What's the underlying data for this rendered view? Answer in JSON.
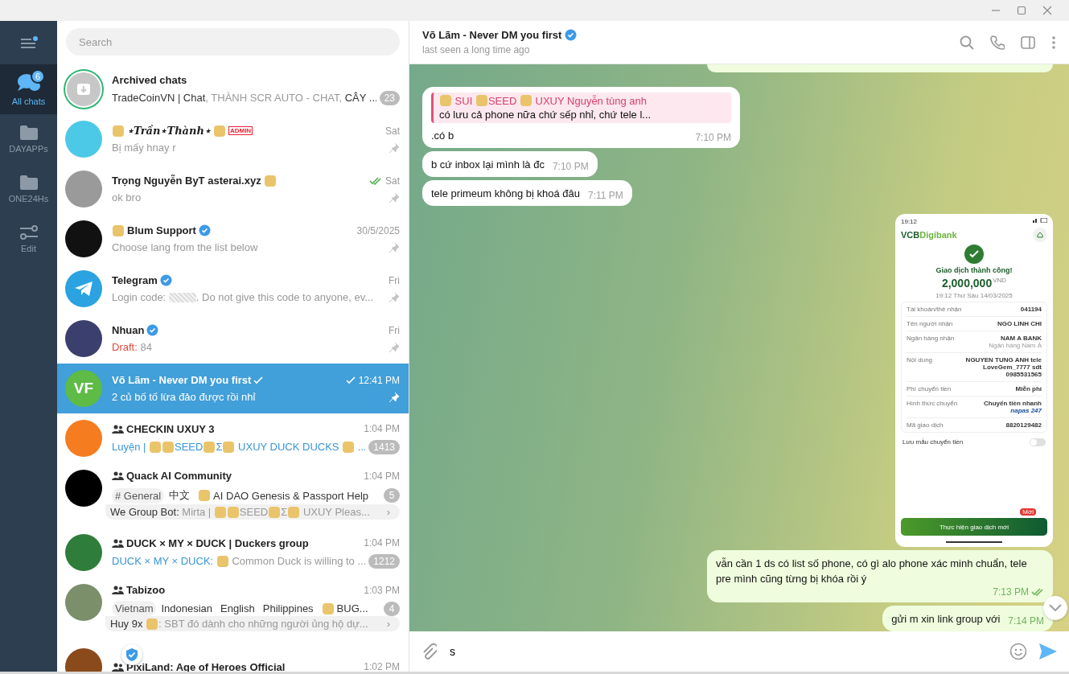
{
  "rail": {
    "items": [
      {
        "kind": "menu",
        "dot": true,
        "selected": false
      },
      {
        "kind": "chats",
        "label": "All chats",
        "badge": "6",
        "selected": true
      },
      {
        "kind": "folder",
        "label": "DAYAPPs",
        "selected": false
      },
      {
        "kind": "folder",
        "label": "ONE24Hs",
        "selected": false
      },
      {
        "kind": "edit",
        "label": "Edit",
        "selected": false
      }
    ]
  },
  "search": {
    "placeholder": "Search"
  },
  "chats": [
    {
      "avatar": {
        "kind": "archive"
      },
      "name": [
        {
          "kind": "text",
          "text": "Archived chats"
        }
      ],
      "preview": [
        {
          "kind": "name",
          "text": "TradeCoinVN | Chat"
        },
        {
          "kind": "text",
          "text": ", THÀNH SCR AUTO - CHAT, "
        },
        {
          "kind": "name",
          "text": "CÂY ..."
        }
      ],
      "unread": "23",
      "muted": true,
      "pinned": false,
      "selected": false
    },
    {
      "avatar": {
        "kind": "photo",
        "color": "#4cc9e6"
      },
      "name": [
        {
          "kind": "emoji"
        },
        {
          "kind": "fancy",
          "text": "⋆Trần⋆Thành⋆"
        },
        {
          "kind": "emoji"
        },
        {
          "kind": "tag",
          "text": "ADMIN"
        }
      ],
      "time": "Sat",
      "preview": [
        {
          "kind": "text",
          "text": "Bị mấy hnay r"
        }
      ],
      "pinned": true,
      "selected": false
    },
    {
      "avatar": {
        "kind": "photo",
        "color": "#9a9a9a"
      },
      "name": [
        {
          "kind": "text",
          "text": "Trọng Nguyễn ByT asterai.xyz"
        },
        {
          "kind": "emoji"
        }
      ],
      "sent": true,
      "read": true,
      "time": "Sat",
      "preview": [
        {
          "kind": "text",
          "text": "ok bro"
        }
      ],
      "pinned": true,
      "selected": false
    },
    {
      "avatar": {
        "kind": "photo",
        "color": "#111111"
      },
      "name": [
        {
          "kind": "emoji"
        },
        {
          "kind": "text",
          "text": "Blum Support"
        }
      ],
      "verified": true,
      "time": "30/5/2025",
      "preview": [
        {
          "kind": "text",
          "text": "Choose lang from the list below"
        }
      ],
      "pinned": true,
      "selected": false
    },
    {
      "avatar": {
        "kind": "telegram"
      },
      "name": [
        {
          "kind": "text",
          "text": "Telegram"
        }
      ],
      "verified": true,
      "time": "Fri",
      "preview": [
        {
          "kind": "text",
          "text": "Login code: "
        },
        {
          "kind": "blur"
        },
        {
          "kind": "text",
          "text": ". Do not give this code to anyone, ev..."
        }
      ],
      "pinned": true,
      "selected": false
    },
    {
      "avatar": {
        "kind": "photo",
        "color": "#3b3f6e"
      },
      "name": [
        {
          "kind": "text",
          "text": "Nhuan"
        }
      ],
      "verified": true,
      "time": "Fri",
      "preview": [
        {
          "kind": "draft",
          "text": "Draft:"
        },
        {
          "kind": "text",
          "text": " 84"
        }
      ],
      "pinned": true,
      "selected": false
    },
    {
      "avatar": {
        "kind": "initials",
        "initials": "VF",
        "color": "#5dbb46"
      },
      "name": [
        {
          "kind": "text",
          "text": "Võ Lãm - Never DM you first"
        }
      ],
      "verified": true,
      "sent": true,
      "read": false,
      "time": "12:41 PM",
      "preview": [
        {
          "kind": "text",
          "text": "2 củ bố tố lừa đảo được rồi nhỉ"
        }
      ],
      "pinned": true,
      "selected": true
    },
    {
      "avatar": {
        "kind": "photo",
        "color": "#f57c1f"
      },
      "group": true,
      "name": [
        {
          "kind": "text",
          "text": "CHECKIN UXUY 3"
        }
      ],
      "time": "1:04 PM",
      "preview": [
        {
          "kind": "sender",
          "text": "Luyện | "
        },
        {
          "kind": "emoji"
        },
        {
          "kind": "emoji"
        },
        {
          "kind": "sender",
          "text": "SEED"
        },
        {
          "kind": "emoji"
        },
        {
          "kind": "sender",
          "text": "Σ"
        },
        {
          "kind": "emoji"
        },
        {
          "kind": "sender",
          "text": " UXUY DUCK DUCKS "
        },
        {
          "kind": "emoji"
        },
        {
          "kind": "sender",
          "text": " ..."
        }
      ],
      "unread": "1413",
      "muted": true,
      "pinned": false,
      "selected": false
    },
    {
      "avatar": {
        "kind": "photo",
        "color": "#000000"
      },
      "group": true,
      "name": [
        {
          "kind": "text",
          "text": "Quack AI Community"
        }
      ],
      "time": "1:04 PM",
      "topics": [
        {
          "label": "# General",
          "selected": true,
          "emoji": false
        },
        {
          "label": "中文",
          "selected": false,
          "emoji": false
        },
        {
          "label": "AI DAO Genesis & Passport Help",
          "selected": false,
          "emoji": true
        }
      ],
      "preview": [
        {
          "kind": "name",
          "text": "We Group Bot: "
        },
        {
          "kind": "text",
          "text": "Mirta | "
        },
        {
          "kind": "emoji"
        },
        {
          "kind": "emoji"
        },
        {
          "kind": "text",
          "text": "SEED"
        },
        {
          "kind": "emoji"
        },
        {
          "kind": "text",
          "text": "Σ"
        },
        {
          "kind": "emoji"
        },
        {
          "kind": "text",
          "text": " UXUY Pleas..."
        },
        {
          "kind": "chevron",
          "text": "›"
        }
      ],
      "unread": "5",
      "muted": true,
      "pinned": false,
      "selected": false
    },
    {
      "avatar": {
        "kind": "photo",
        "color": "#2f7d3a"
      },
      "group": true,
      "name": [
        {
          "kind": "text",
          "text": "DUCK × MY × DUCK | Duckers group"
        }
      ],
      "time": "1:04 PM",
      "preview": [
        {
          "kind": "sender",
          "text": "DUCK × MY × DUCK: "
        },
        {
          "kind": "emoji"
        },
        {
          "kind": "text",
          "text": " Common Duck is willing to ..."
        }
      ],
      "unread": "1212",
      "muted": true,
      "pinned": false,
      "selected": false
    },
    {
      "avatar": {
        "kind": "photo",
        "color": "#7a8f6a"
      },
      "group": true,
      "name": [
        {
          "kind": "text",
          "text": "Tabizoo"
        }
      ],
      "time": "1:03 PM",
      "topics": [
        {
          "label": "Vietnam",
          "selected": true,
          "emoji": false
        },
        {
          "label": "Indonesian",
          "selected": false,
          "emoji": false
        },
        {
          "label": "English",
          "selected": false,
          "emoji": false
        },
        {
          "label": "Philippines",
          "selected": false,
          "emoji": false
        },
        {
          "label": "BUG...",
          "selected": false,
          "emoji": true
        }
      ],
      "preview": [
        {
          "kind": "name",
          "text": "Huy 9x "
        },
        {
          "kind": "emoji"
        },
        {
          "kind": "text",
          "text": ": SBT đó dành cho những người ủng hộ dự..."
        },
        {
          "kind": "chevron",
          "text": "›"
        }
      ],
      "unread": "4",
      "muted": true,
      "pinned": false,
      "selected": false
    },
    {
      "avatar": {
        "kind": "photo",
        "color": "#8a4a1c"
      },
      "group": true,
      "name": [
        {
          "kind": "text",
          "text": "PixiLand: Age of Heroes Official"
        }
      ],
      "time": "1:02 PM",
      "selected": false
    }
  ],
  "chat": {
    "title": "Võ Lãm - Never DM you first",
    "verified": true,
    "status": "last seen a long time ago",
    "messages": [
      {
        "kind": "fragment"
      },
      {
        "kind": "incoming",
        "reply": {
          "sender": [
            {
              "kind": "emoji"
            },
            {
              "kind": "text",
              "text": " SUI "
            },
            {
              "kind": "emoji"
            },
            {
              "kind": "text",
              "text": "SEED "
            },
            {
              "kind": "emoji"
            },
            {
              "kind": "text",
              "text": " UXUY Nguyễn tùng anh"
            }
          ],
          "text": "có lưu cả phone nữa chứ sếp nhỉ, chứ tele l..."
        },
        "text": ".có b",
        "time": "7:10 PM"
      },
      {
        "kind": "incoming",
        "text": "b cứ inbox lại mình là đc",
        "time": "7:10 PM"
      },
      {
        "kind": "incoming",
        "text": "tele primeum không bị khoá đâu",
        "time": "7:11 PM"
      },
      {
        "kind": "photo",
        "shot": {
          "clock": "19:12",
          "logo_a": "VCB",
          "logo_b": "Digibank",
          "result": "Giao dịch thành công!",
          "amount": "2,000,000",
          "currency": "VND",
          "datetime": "19:12 Thứ Sáu 14/03/2025",
          "rows": [
            {
              "label": "Tài khoản/thẻ nhận",
              "value": "041194"
            },
            {
              "label": "Tên người nhận",
              "value": "NGO LINH CHI"
            },
            {
              "label": "Ngân hàng nhận",
              "value": "NAM A BANK",
              "sub": "Ngân hàng Nam Á"
            },
            {
              "label": "Nội dung",
              "value": "NGUYEN TUNG ANH tele LoveGem_7777 sdt 0985531565"
            },
            {
              "label": "Phí chuyển tiền",
              "value": "Miễn phí"
            },
            {
              "label": "Hình thức chuyển",
              "value": "Chuyển tiền nhanh",
              "sub": "napas 247"
            },
            {
              "label": "Mã giao dịch",
              "value": "8820129482"
            }
          ],
          "save_label": "Lưu mẫu chuyển tiền",
          "save_on": false,
          "new_badge": "Mới",
          "button": "Thực hiện giao dịch mới"
        }
      },
      {
        "kind": "outgoing",
        "text": "vẫn cần 1 ds có list số phone, có gì alo phone xác minh chuẩn, tele pre mình cũng từng bị khóa rồi ý",
        "time": "7:13 PM",
        "sent": true,
        "read": true
      },
      {
        "kind": "outgoing",
        "text": "gửi m xin link group với",
        "time": "7:14 PM"
      }
    ]
  },
  "composer": {
    "value": "s"
  }
}
